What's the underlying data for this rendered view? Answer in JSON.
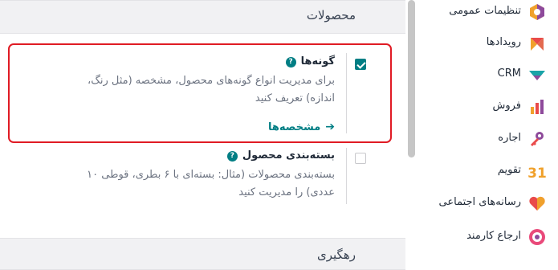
{
  "section_products": {
    "title": "محصولات"
  },
  "variants": {
    "title": "گونه‌ها",
    "help_icon": "question-circle-icon",
    "description": "برای مدیریت انواع گونه‌های محصول، مشخصه (مثل رنگ، اندازه) تعریف کنید",
    "checked": true,
    "link_label": "مشخصه‌ها",
    "link_icon": "arrow-right-icon"
  },
  "packaging": {
    "title": "بسته‌بندی محصول",
    "help_icon": "question-circle-icon",
    "description": "بسته‌بندی محصولات (مثال: بسته‌ای با ۶ بطری، قوطی ۱۰ عددی) را مدیریت کنید",
    "checked": false
  },
  "section_tracking": {
    "title": "رهگیری"
  },
  "sidebar": {
    "items": [
      {
        "label": "تنظیمات عمومی",
        "icon": "general-settings-icon"
      },
      {
        "label": "رویدادها",
        "icon": "events-icon"
      },
      {
        "label": "CRM",
        "icon": "crm-icon"
      },
      {
        "label": "فروش",
        "icon": "sales-icon"
      },
      {
        "label": "اجاره",
        "icon": "rental-icon"
      },
      {
        "label": "تقویم",
        "icon": "calendar-icon",
        "icon_text": "31"
      },
      {
        "label": "رسانه‌های اجتماعی",
        "icon": "social-media-icon"
      },
      {
        "label": "ارجاع کارمند",
        "icon": "employee-referral-icon"
      }
    ]
  },
  "colors": {
    "accent": "#017e84",
    "highlight_border": "#e01b24",
    "section_header_bg": "#f1f1f3"
  }
}
